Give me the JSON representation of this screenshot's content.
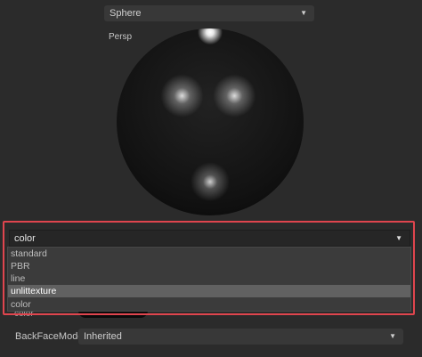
{
  "mesh_select": {
    "value": "Sphere",
    "icon": "chevron-down-icon"
  },
  "viewport": {
    "label": "Persp"
  },
  "shader_select": {
    "value": "color",
    "icon": "chevron-down-icon",
    "options": [
      "standard",
      "PBR",
      "line",
      "unlittexture",
      "color"
    ],
    "selected_option": "unlittexture"
  },
  "hidden_field": {
    "label": "color"
  },
  "backface": {
    "label": "BackFaceMode",
    "value": "Inherited",
    "icon": "chevron-down-icon"
  },
  "colors": {
    "highlight": "#e0454e",
    "selected_option_bg": "#616161"
  }
}
